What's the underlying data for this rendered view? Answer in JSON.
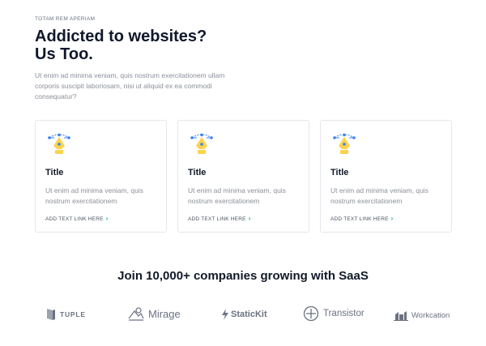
{
  "section": {
    "eyebrow": "TOTAM REM APERIAM",
    "headline_line1": "Addicted to websites?",
    "headline_line2": "Us Too.",
    "intro": "Ut enim ad minima veniam, quis nostrum exercitationem ullam corporis suscipit laboriosam, nisi ut aliquid ex ea commodi consequatur?"
  },
  "cards": [
    {
      "icon": "pen-tool-icon",
      "title": "Title",
      "body": "Ut enim ad minima veniam, quis nostrum exercitationem",
      "link": "ADD TEXT LINK HERE"
    },
    {
      "icon": "pen-tool-icon",
      "title": "Title",
      "body": "Ut enim ad minima veniam, quis nostrum exercitationem",
      "link": "ADD TEXT LINK HERE"
    },
    {
      "icon": "pen-tool-icon",
      "title": "Title",
      "body": "Ut enim ad minima veniam, quis nostrum exercitationem",
      "link": "ADD TEXT LINK HERE"
    }
  ],
  "companies": {
    "heading": "Join 10,000+ companies growing with SaaS",
    "logos": [
      {
        "icon": "tuple-logo-icon",
        "name": "TUPLE"
      },
      {
        "icon": "mirage-logo-icon",
        "name": "Mirage"
      },
      {
        "icon": "statickit-logo-icon",
        "name": "StaticKit"
      },
      {
        "icon": "transistor-logo-icon",
        "name": "Transistor"
      },
      {
        "icon": "workcation-logo-icon",
        "name": "Workcation"
      }
    ]
  },
  "colors": {
    "accent": "#10b981",
    "heading": "#0f172a",
    "muted": "#8a8f98",
    "icon_yellow": "#fcd34d",
    "icon_blue": "#3b82f6"
  }
}
